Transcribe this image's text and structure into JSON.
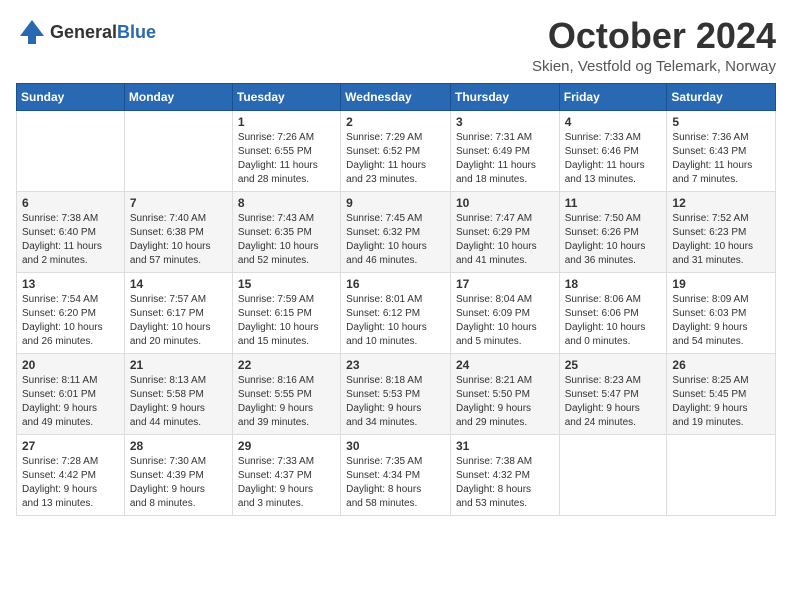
{
  "header": {
    "logo_general": "General",
    "logo_blue": "Blue",
    "month_title": "October 2024",
    "subtitle": "Skien, Vestfold og Telemark, Norway"
  },
  "days_of_week": [
    "Sunday",
    "Monday",
    "Tuesday",
    "Wednesday",
    "Thursday",
    "Friday",
    "Saturday"
  ],
  "weeks": [
    [
      {
        "day": "",
        "info": ""
      },
      {
        "day": "",
        "info": ""
      },
      {
        "day": "1",
        "info": "Sunrise: 7:26 AM\nSunset: 6:55 PM\nDaylight: 11 hours\nand 28 minutes."
      },
      {
        "day": "2",
        "info": "Sunrise: 7:29 AM\nSunset: 6:52 PM\nDaylight: 11 hours\nand 23 minutes."
      },
      {
        "day": "3",
        "info": "Sunrise: 7:31 AM\nSunset: 6:49 PM\nDaylight: 11 hours\nand 18 minutes."
      },
      {
        "day": "4",
        "info": "Sunrise: 7:33 AM\nSunset: 6:46 PM\nDaylight: 11 hours\nand 13 minutes."
      },
      {
        "day": "5",
        "info": "Sunrise: 7:36 AM\nSunset: 6:43 PM\nDaylight: 11 hours\nand 7 minutes."
      }
    ],
    [
      {
        "day": "6",
        "info": "Sunrise: 7:38 AM\nSunset: 6:40 PM\nDaylight: 11 hours\nand 2 minutes."
      },
      {
        "day": "7",
        "info": "Sunrise: 7:40 AM\nSunset: 6:38 PM\nDaylight: 10 hours\nand 57 minutes."
      },
      {
        "day": "8",
        "info": "Sunrise: 7:43 AM\nSunset: 6:35 PM\nDaylight: 10 hours\nand 52 minutes."
      },
      {
        "day": "9",
        "info": "Sunrise: 7:45 AM\nSunset: 6:32 PM\nDaylight: 10 hours\nand 46 minutes."
      },
      {
        "day": "10",
        "info": "Sunrise: 7:47 AM\nSunset: 6:29 PM\nDaylight: 10 hours\nand 41 minutes."
      },
      {
        "day": "11",
        "info": "Sunrise: 7:50 AM\nSunset: 6:26 PM\nDaylight: 10 hours\nand 36 minutes."
      },
      {
        "day": "12",
        "info": "Sunrise: 7:52 AM\nSunset: 6:23 PM\nDaylight: 10 hours\nand 31 minutes."
      }
    ],
    [
      {
        "day": "13",
        "info": "Sunrise: 7:54 AM\nSunset: 6:20 PM\nDaylight: 10 hours\nand 26 minutes."
      },
      {
        "day": "14",
        "info": "Sunrise: 7:57 AM\nSunset: 6:17 PM\nDaylight: 10 hours\nand 20 minutes."
      },
      {
        "day": "15",
        "info": "Sunrise: 7:59 AM\nSunset: 6:15 PM\nDaylight: 10 hours\nand 15 minutes."
      },
      {
        "day": "16",
        "info": "Sunrise: 8:01 AM\nSunset: 6:12 PM\nDaylight: 10 hours\nand 10 minutes."
      },
      {
        "day": "17",
        "info": "Sunrise: 8:04 AM\nSunset: 6:09 PM\nDaylight: 10 hours\nand 5 minutes."
      },
      {
        "day": "18",
        "info": "Sunrise: 8:06 AM\nSunset: 6:06 PM\nDaylight: 10 hours\nand 0 minutes."
      },
      {
        "day": "19",
        "info": "Sunrise: 8:09 AM\nSunset: 6:03 PM\nDaylight: 9 hours\nand 54 minutes."
      }
    ],
    [
      {
        "day": "20",
        "info": "Sunrise: 8:11 AM\nSunset: 6:01 PM\nDaylight: 9 hours\nand 49 minutes."
      },
      {
        "day": "21",
        "info": "Sunrise: 8:13 AM\nSunset: 5:58 PM\nDaylight: 9 hours\nand 44 minutes."
      },
      {
        "day": "22",
        "info": "Sunrise: 8:16 AM\nSunset: 5:55 PM\nDaylight: 9 hours\nand 39 minutes."
      },
      {
        "day": "23",
        "info": "Sunrise: 8:18 AM\nSunset: 5:53 PM\nDaylight: 9 hours\nand 34 minutes."
      },
      {
        "day": "24",
        "info": "Sunrise: 8:21 AM\nSunset: 5:50 PM\nDaylight: 9 hours\nand 29 minutes."
      },
      {
        "day": "25",
        "info": "Sunrise: 8:23 AM\nSunset: 5:47 PM\nDaylight: 9 hours\nand 24 minutes."
      },
      {
        "day": "26",
        "info": "Sunrise: 8:25 AM\nSunset: 5:45 PM\nDaylight: 9 hours\nand 19 minutes."
      }
    ],
    [
      {
        "day": "27",
        "info": "Sunrise: 7:28 AM\nSunset: 4:42 PM\nDaylight: 9 hours\nand 13 minutes."
      },
      {
        "day": "28",
        "info": "Sunrise: 7:30 AM\nSunset: 4:39 PM\nDaylight: 9 hours\nand 8 minutes."
      },
      {
        "day": "29",
        "info": "Sunrise: 7:33 AM\nSunset: 4:37 PM\nDaylight: 9 hours\nand 3 minutes."
      },
      {
        "day": "30",
        "info": "Sunrise: 7:35 AM\nSunset: 4:34 PM\nDaylight: 8 hours\nand 58 minutes."
      },
      {
        "day": "31",
        "info": "Sunrise: 7:38 AM\nSunset: 4:32 PM\nDaylight: 8 hours\nand 53 minutes."
      },
      {
        "day": "",
        "info": ""
      },
      {
        "day": "",
        "info": ""
      }
    ]
  ]
}
